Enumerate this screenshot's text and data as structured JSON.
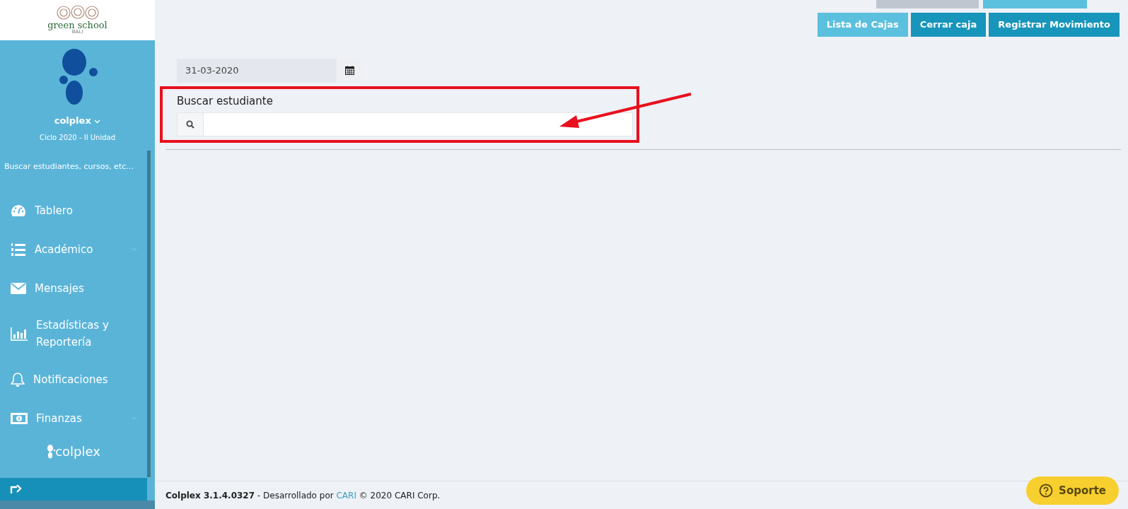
{
  "sidebar": {
    "brand": "green school",
    "brand_sub": "BALI",
    "user": "colplex",
    "cycle": "Ciclo 2020 - II Unidad",
    "search_placeholder": "Buscar estudiantes, cursos, etc...",
    "items": [
      {
        "label": "Tablero",
        "expandable": false
      },
      {
        "label": "Académico",
        "expandable": true
      },
      {
        "label": "Mensajes",
        "expandable": false
      },
      {
        "label": "Estadísticas y Reportería",
        "expandable": false
      },
      {
        "label": "Notificaciones",
        "expandable": false
      },
      {
        "label": "Finanzas",
        "expandable": true
      }
    ],
    "footer_logo": "colplex"
  },
  "toolbar": {
    "buttons": [
      {
        "label": "Lista de Cajas",
        "kind": "info"
      },
      {
        "label": "Cerrar caja",
        "kind": "primary"
      },
      {
        "label": "Registrar Movimiento",
        "kind": "primary"
      }
    ]
  },
  "date_field": {
    "value": "31-03-2020"
  },
  "student_search": {
    "label": "Buscar estudiante"
  },
  "footer": {
    "text": "**Colplex 3.1.4.0327** - Desarrollado por",
    "link": "CARI",
    "text_after": "© 2020 CARI Corp."
  },
  "support_button": {
    "label": "Soporte"
  }
}
